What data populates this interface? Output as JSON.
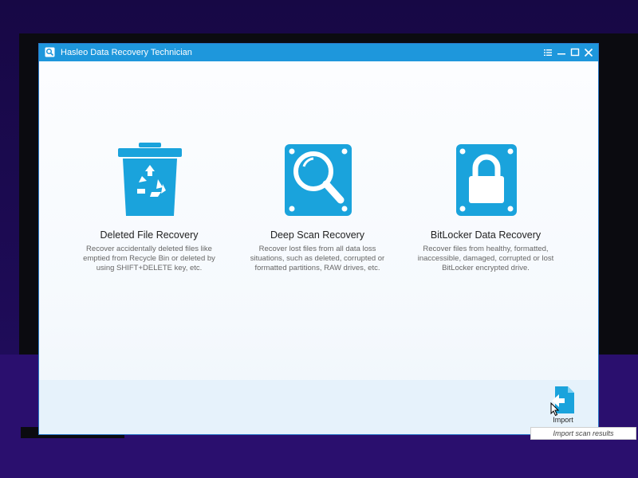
{
  "window": {
    "title": "Hasleo Data Recovery Technician",
    "controls": [
      "menu",
      "minimize",
      "maximize",
      "close"
    ]
  },
  "colors": {
    "accent": "#1e97dc",
    "icon_blue": "#1aa3dc",
    "text_primary": "#222222",
    "text_secondary": "#666666"
  },
  "cards": [
    {
      "icon": "recycle-bin-icon",
      "title": "Deleted File Recovery",
      "desc": [
        "Recover accidentally deleted files like",
        "emptied from Recycle Bin or deleted by",
        "using SHIFT+DELETE key, etc."
      ]
    },
    {
      "icon": "magnifier-icon",
      "title": "Deep Scan Recovery",
      "desc": [
        "Recover lost files from all data loss",
        "situations, such as deleted, corrupted or",
        "formatted partitions, RAW drives, etc."
      ]
    },
    {
      "icon": "padlock-icon",
      "title": "BitLocker Data Recovery",
      "desc": [
        "Recover files from healthy, formatted,",
        "inaccessible, damaged, corrupted or lost",
        "BitLocker encrypted drive."
      ]
    }
  ],
  "import": {
    "label": "Import",
    "tooltip": "Import scan results",
    "icon": "import-icon"
  }
}
